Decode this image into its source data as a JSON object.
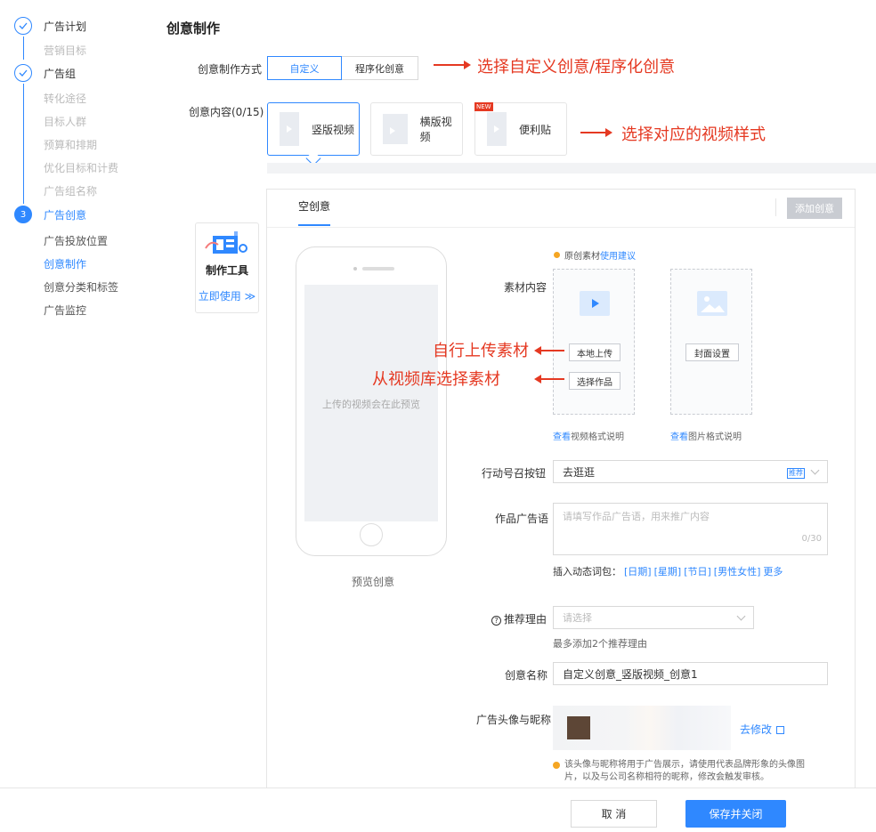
{
  "sidebar": {
    "step1": {
      "label": "广告计划",
      "subs": [
        "营销目标"
      ]
    },
    "step2": {
      "label": "广告组",
      "subs": [
        "转化途径",
        "目标人群",
        "预算和排期",
        "优化目标和计费",
        "广告组名称"
      ]
    },
    "step3": {
      "number": "3",
      "label": "广告创意",
      "subs": [
        "广告投放位置",
        "创意制作",
        "创意分类和标签",
        "广告监控"
      ]
    }
  },
  "page": {
    "title": "创意制作"
  },
  "mode": {
    "label": "创意制作方式",
    "options": [
      "自定义",
      "程序化创意"
    ],
    "selected": "自定义"
  },
  "content": {
    "label": "创意内容(0/15)",
    "cards": [
      {
        "label": "竖版视频",
        "selected": true
      },
      {
        "label": "横版视频"
      },
      {
        "label": "便利贴",
        "badge": "NEW"
      }
    ]
  },
  "annotations": {
    "mode": "选择自定义创意/程序化创意",
    "style": "选择对应的视频样式",
    "upload": "自行上传素材",
    "library": "从视频库选择素材"
  },
  "panel": {
    "tab": "空创意",
    "add_button": "添加创意"
  },
  "tool": {
    "title": "制作工具",
    "link": "立即使用 ≫"
  },
  "preview": {
    "screen_text": "上传的视频会在此预览",
    "label": "预览创意"
  },
  "material": {
    "hint_prefix": "原创素材",
    "hint_link": "使用建议",
    "label": "素材内容",
    "local_upload": "本地上传",
    "choose_work": "选择作品",
    "cover": "封面设置",
    "video_link_a": "查看",
    "video_link_b": "视频格式说明",
    "image_link_a": "查看",
    "image_link_b": "图片格式说明"
  },
  "cta": {
    "label": "行动号召按钮",
    "value": "去逛逛",
    "badge": "推荐"
  },
  "adcopy": {
    "label": "作品广告语",
    "placeholder": "请填写作品广告语，用来推广内容",
    "counter": "0/30"
  },
  "dynamic": {
    "label": "插入动态词包：",
    "words": [
      "[日期]",
      "[星期]",
      "[节日]",
      "[男性女性]"
    ],
    "more": "更多"
  },
  "reason": {
    "label": "推荐理由",
    "placeholder": "请选择",
    "hint": "最多添加2个推荐理由"
  },
  "name": {
    "label": "创意名称",
    "value": "自定义创意_竖版视频_创意1"
  },
  "avatar": {
    "label": "广告头像与昵称",
    "edit": "去修改",
    "note": "该头像与昵称将用于广告展示，请使用代表品牌形象的头像图片，以及与公司名称相符的昵称，修改会触发审核。"
  },
  "footer": {
    "cancel": "取 消",
    "save": "保存并关闭"
  },
  "colors": {
    "primary": "#2f88ff",
    "annotation": "#e53922"
  }
}
